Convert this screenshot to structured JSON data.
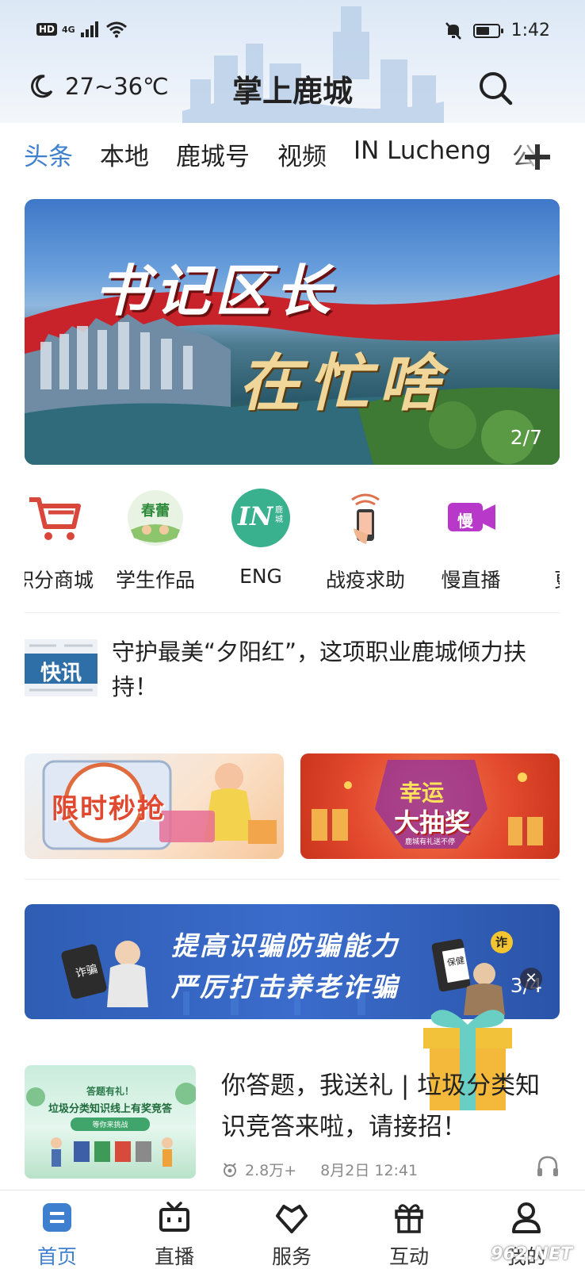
{
  "status_bar": {
    "hd": "HD",
    "network": "4G",
    "time": "1:42",
    "battery_level": 0.6
  },
  "header": {
    "weather": "27~36℃",
    "title": "掌上鹿城"
  },
  "tabs": [
    "头条",
    "本地",
    "鹿城号",
    "视频",
    "IN Lucheng",
    "公"
  ],
  "banner": {
    "title": "书记区长",
    "subtitle": "在忙啥",
    "page": "2/7"
  },
  "quick_entries": [
    {
      "label": "积分商城",
      "icon": "cart-icon"
    },
    {
      "label": "学生作品",
      "icon": "student-works-icon",
      "badge": "春蕾"
    },
    {
      "label": "ENG",
      "icon": "in-lucheng-icon",
      "badge": "IN",
      "badge_small": "鹿城"
    },
    {
      "label": "战疫求助",
      "icon": "phone-help-icon"
    },
    {
      "label": "慢直播",
      "icon": "slow-live-icon",
      "badge": "慢"
    },
    {
      "label": "更多",
      "icon": "more-icon"
    }
  ],
  "flash_news": {
    "badge": "快讯",
    "text": "守护最美“夕阳红”，这项职业鹿城倾力扶持！"
  },
  "promos": [
    {
      "label": "限时秒抢"
    },
    {
      "label_top": "幸运",
      "label_bottom": "大抽奖",
      "sub": "鹿城有礼送不停"
    }
  ],
  "fraud_banner": {
    "line1": "提高识骗防骗能力",
    "line2": "严厉打击养老诈骗",
    "tag_left": "诈骗",
    "tag_right": "保健",
    "tag_bubble": "诈",
    "page": "3/4"
  },
  "article": {
    "thumb_line1": "答题有礼！",
    "thumb_line2": "垃圾分类知识线上有奖竞答",
    "thumb_line3": "等你来挑战",
    "title": "你答题，我送礼 | 垃圾分类知识竞答来啦，请接招！",
    "views": "2.8万+",
    "date": "8月2日 12:41"
  },
  "bottom_nav": [
    {
      "label": "首页",
      "active": true
    },
    {
      "label": "直播",
      "active": false
    },
    {
      "label": "服务",
      "active": false
    },
    {
      "label": "互动",
      "active": false
    },
    {
      "label": "我的",
      "active": false
    }
  ],
  "watermark": "962.NET",
  "colors": {
    "accent": "#3f7fcf",
    "fraud_banner": "#2f5db4",
    "promo_red": "#e34a2e"
  }
}
